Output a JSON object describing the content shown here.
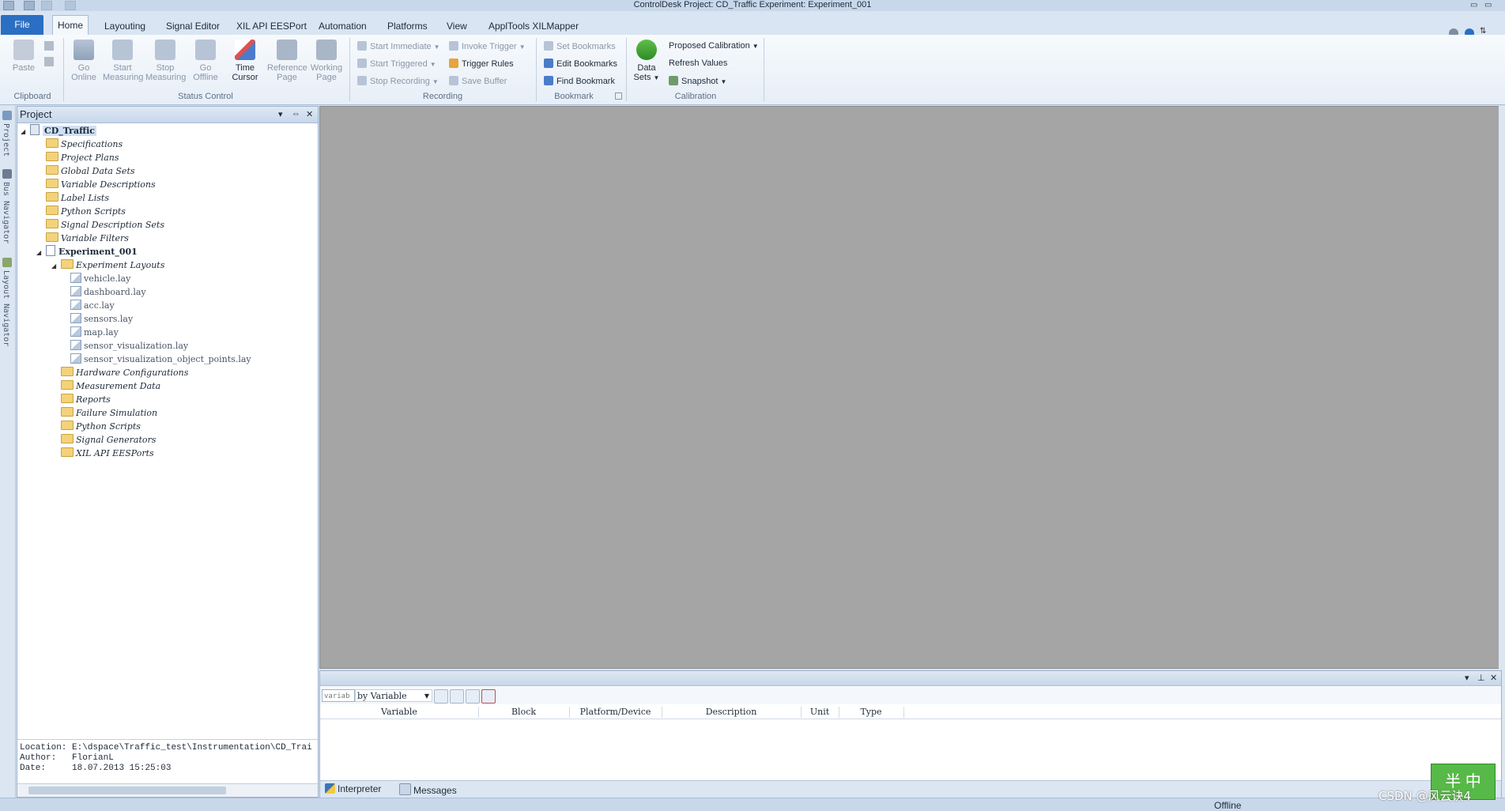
{
  "window": {
    "title": "ControlDesk  Project: CD_Traffic  Experiment: Experiment_001"
  },
  "ribbon_tabs": [
    {
      "label": "File"
    },
    {
      "label": "Home"
    },
    {
      "label": "Layouting"
    },
    {
      "label": "Signal Editor"
    },
    {
      "label": "XIL API EESPort"
    },
    {
      "label": "Automation"
    },
    {
      "label": "Platforms"
    },
    {
      "label": "View"
    },
    {
      "label": "ApplTools XILMapper"
    }
  ],
  "ribbon": {
    "clipboard": {
      "group_label": "Clipboard",
      "paste": "Paste"
    },
    "status_control": {
      "group_label": "Status Control",
      "go_online": "Go Online",
      "start_measuring": "Start Measuring",
      "stop_measuring": "Stop Measuring",
      "go_offline": "Go Offline",
      "time_cursor": "Time Cursor",
      "reference_page": "Reference Page",
      "working_page": "Working Page"
    },
    "recording": {
      "group_label": "Recording",
      "start_immediate": "Start Immediate",
      "start_triggered": "Start Triggered",
      "stop_recording": "Stop Recording",
      "invoke_trigger": "Invoke Trigger",
      "trigger_rules": "Trigger Rules",
      "save_buffer": "Save Buffer"
    },
    "bookmark": {
      "group_label": "Bookmark",
      "set_bookmarks": "Set Bookmarks",
      "edit_bookmarks": "Edit Bookmarks",
      "find_bookmark": "Find Bookmark"
    },
    "calibration": {
      "group_label": "Calibration",
      "data_sets": "Data Sets",
      "proposed_calibration": "Proposed Calibration",
      "refresh_values": "Refresh Values",
      "snapshot": "Snapshot"
    }
  },
  "left_strip": {
    "project": "Project",
    "bus_navigator": "Bus Navigator",
    "layout_navigator": "Layout Navigator"
  },
  "project_panel": {
    "title": "Project",
    "root": "CD_Traffic",
    "root_children": [
      "Specifications",
      "Project Plans",
      "Global Data Sets",
      "Variable Descriptions",
      "Label Lists",
      "Python Scripts",
      "Signal Description Sets",
      "Variable Filters"
    ],
    "experiment": "Experiment_001",
    "experiment_layouts": "Experiment Layouts",
    "layouts": [
      "vehicle.lay",
      "dashboard.lay",
      "acc.lay",
      "sensors.lay",
      "map.lay",
      "sensor_visualization.lay",
      "sensor_visualization_object_points.lay"
    ],
    "experiment_children": [
      "Hardware Configurations",
      "Measurement Data",
      "Reports",
      "Failure Simulation",
      "Python Scripts",
      "Signal Generators",
      "XIL API EESPorts"
    ],
    "info": {
      "location_label": "Location:",
      "location_value": "E:\\dspace\\Traffic_test\\Instrumentation\\CD_Trai",
      "author_label": "Author:",
      "author_value": "FlorianL",
      "date_label": "Date:",
      "date_value": "18.07.2013 15:25:03"
    }
  },
  "variable_panel": {
    "search_placeholder": "variab",
    "filter_mode": "by Variable",
    "columns": [
      "Variable",
      "Block",
      "Platform/Device",
      "Description",
      "Unit",
      "Type"
    ],
    "tabs": [
      "Interpreter",
      "Messages"
    ]
  },
  "status": {
    "state": "Offline"
  },
  "overlay": {
    "watermark": "CSDN @风云诀4",
    "ime": "半 中"
  },
  "colors": {
    "file_tab": "#2a6fc3",
    "workspace": "#a5a5a5",
    "folder": "#f3d27a"
  }
}
